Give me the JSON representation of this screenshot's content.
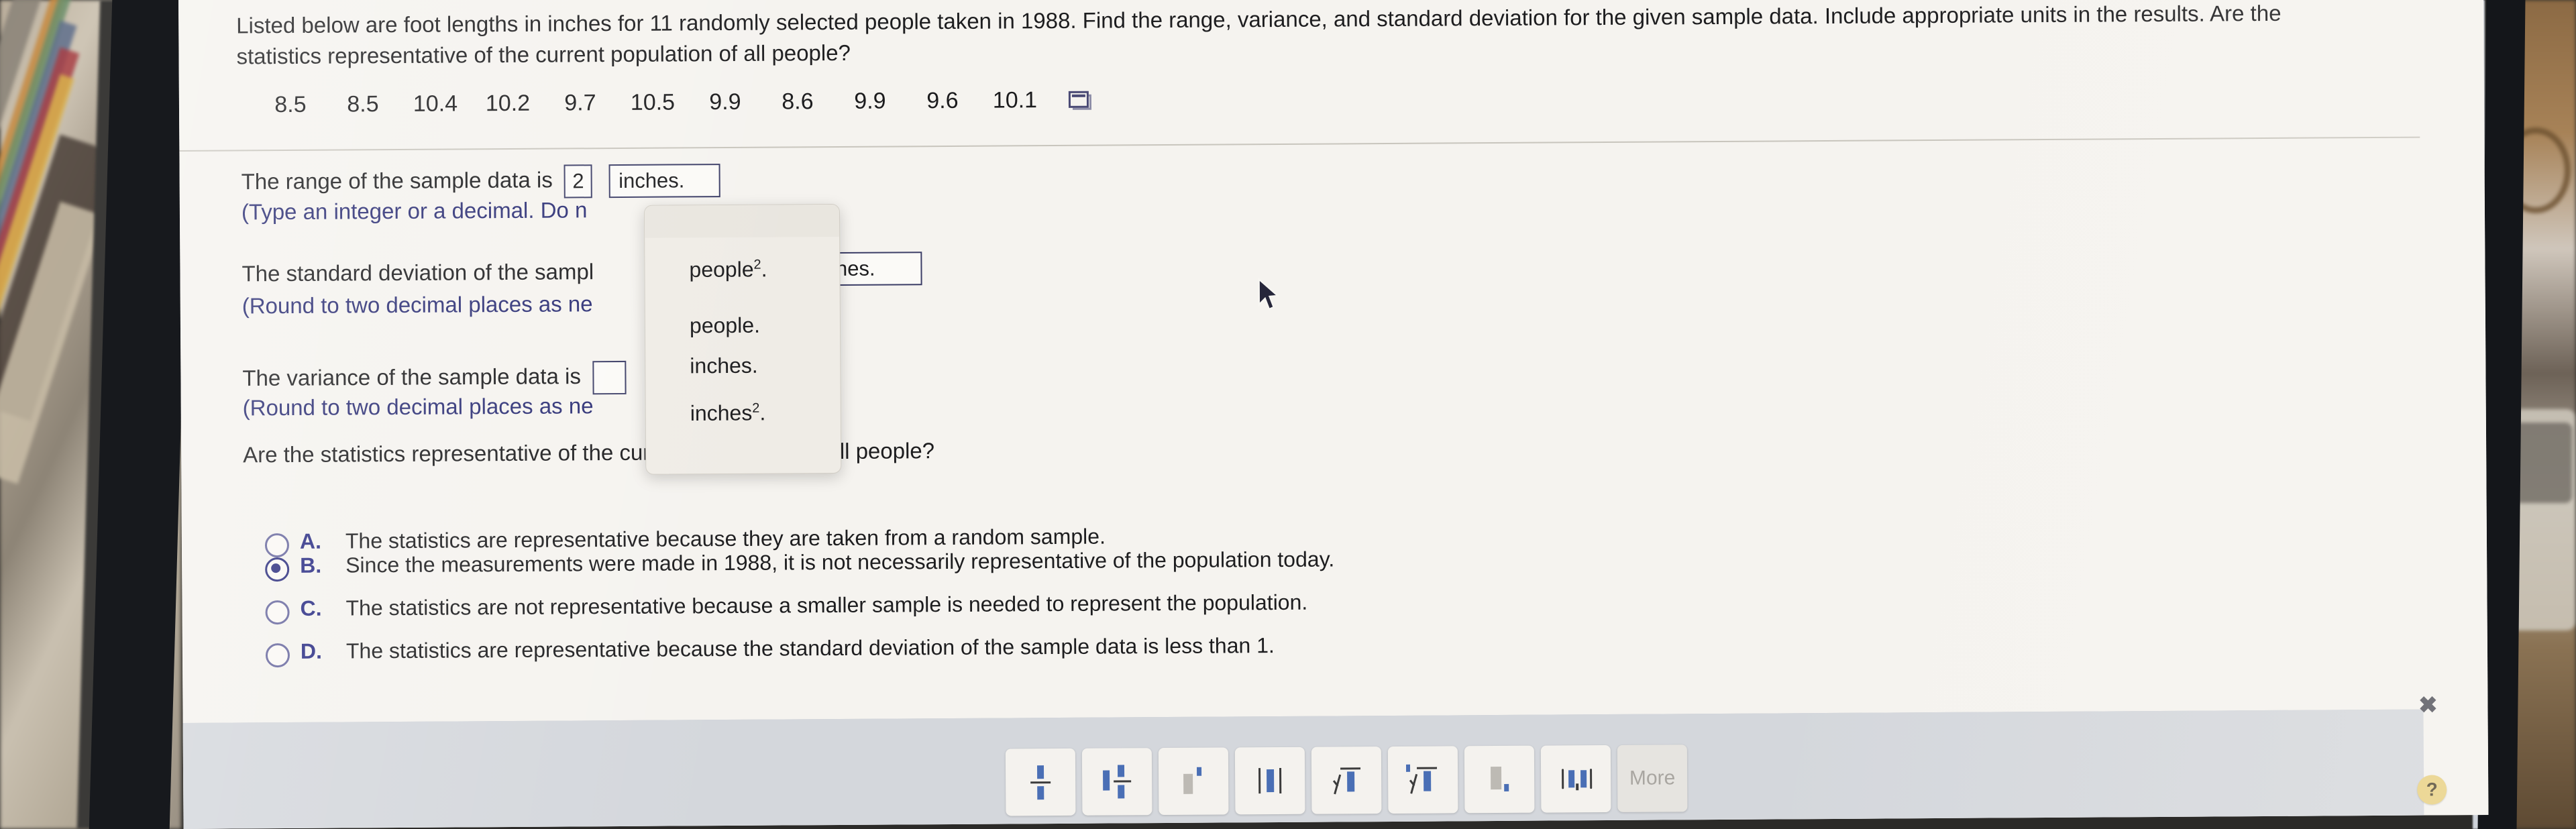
{
  "question": {
    "line1": "Listed below are foot lengths in inches for 11 randomly selected people taken in 1988. Find the range, variance, and standard deviation for the given sample data. Include appropriate units in the results. Are the",
    "line2": "statistics representative of the current population of all people?",
    "data_values": [
      "8.5",
      "8.5",
      "10.4",
      "10.2",
      "9.7",
      "10.5",
      "9.9",
      "8.6",
      "9.9",
      "9.6",
      "10.1"
    ],
    "popup_icon": "popup-window-icon"
  },
  "answers": {
    "range_prefix": "The range of the sample data is",
    "range_value": "2",
    "range_unit": "inches.",
    "range_note": "(Type an integer or a decimal. Do n",
    "sd_prefix": "The standard deviation of the sampl",
    "sd_unit": "ches.",
    "sd_note": "(Round to two decimal places as ne",
    "var_prefix": "The variance of the sample data is",
    "var_note": "(Round to two decimal places as ne",
    "representative_question": "Are the statistics representative of the current population of all people?"
  },
  "dropdown": {
    "open": true,
    "options": [
      {
        "text": "people",
        "sup": "2",
        "suffix": "."
      },
      {
        "text": "people.",
        "sup": "",
        "suffix": ""
      },
      {
        "text": "inches.",
        "sup": "",
        "suffix": ""
      },
      {
        "text": "inches",
        "sup": "2",
        "suffix": "."
      }
    ]
  },
  "choices": [
    {
      "letter": "A.",
      "text": "The statistics are representative because they are taken from a random sample.",
      "selected": false
    },
    {
      "letter": "B.",
      "text": "Since the measurements were made in 1988, it is not necessarily representative of the population today.",
      "selected": true
    },
    {
      "letter": "C.",
      "text": "The statistics are not representative because a smaller sample is needed to represent the population.",
      "selected": false
    },
    {
      "letter": "D.",
      "text": "The statistics are representative because the standard deviation of the sample data is less than 1.",
      "selected": false
    }
  ],
  "toolbar": {
    "buttons": [
      {
        "name": "fraction-icon"
      },
      {
        "name": "mixed-fraction-icon"
      },
      {
        "name": "exponent-icon"
      },
      {
        "name": "absolute-value-icon"
      },
      {
        "name": "square-root-icon"
      },
      {
        "name": "nth-root-icon"
      },
      {
        "name": "subscript-icon"
      },
      {
        "name": "interval-notation-icon"
      }
    ],
    "more_label": "More"
  },
  "controls": {
    "close_glyph": "✖",
    "help_glyph": "?"
  },
  "colors": {
    "accent_blue": "#2c2f85",
    "box_border": "#3b3d66",
    "footer_gray": "#d4d7dc",
    "help_yellow": "#e8cf7c"
  }
}
